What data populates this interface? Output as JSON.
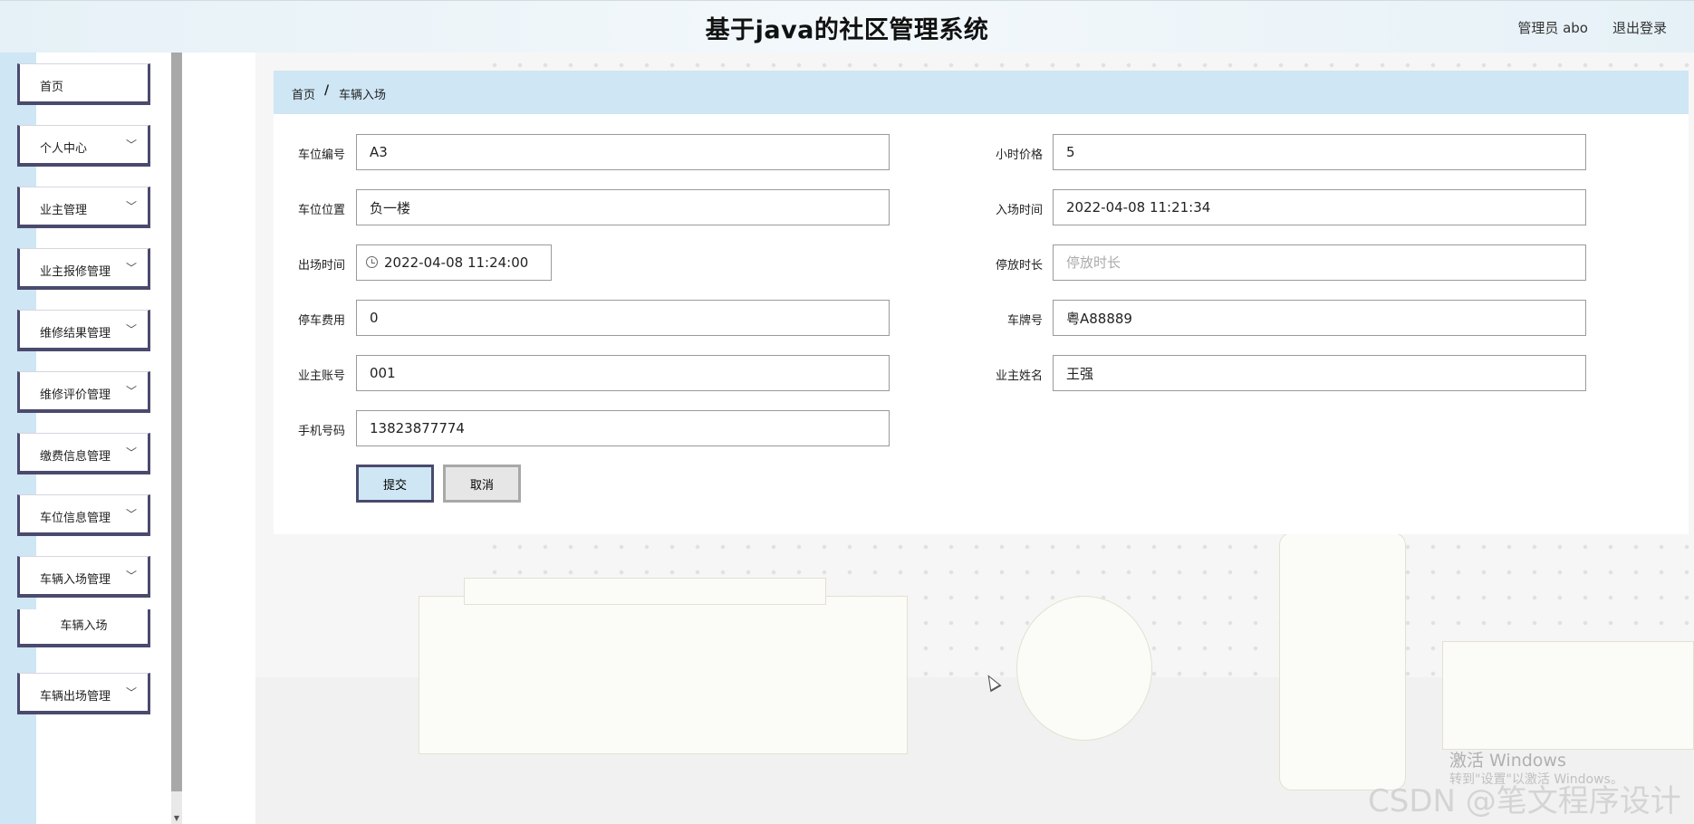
{
  "header": {
    "title": "基于java的社区管理系统",
    "user": "管理员 abo",
    "logout": "退出登录"
  },
  "sidebar": {
    "items": [
      {
        "label": "首页"
      },
      {
        "label": "个人中心"
      },
      {
        "label": "业主管理"
      },
      {
        "label": "业主报修管理"
      },
      {
        "label": "维修结果管理"
      },
      {
        "label": "维修评价管理"
      },
      {
        "label": "缴费信息管理"
      },
      {
        "label": "车位信息管理"
      },
      {
        "label": "车辆入场管理"
      },
      {
        "label": "车辆出场管理"
      }
    ],
    "sub_item": "车辆入场",
    "chevron": "chevron-down-icon"
  },
  "breadcrumb": {
    "home": "首页",
    "sep": "/",
    "current": "车辆入场"
  },
  "form": {
    "spot_no": {
      "label": "车位编号",
      "value": "A3"
    },
    "hour_price": {
      "label": "小时价格",
      "value": "5"
    },
    "spot_loc": {
      "label": "车位位置",
      "value": "负一楼"
    },
    "entry_time": {
      "label": "入场时间",
      "value": "2022-04-08 11:21:34"
    },
    "exit_time": {
      "label": "出场时间",
      "value": "2022-04-08 11:24:00"
    },
    "duration": {
      "label": "停放时长",
      "value": "",
      "placeholder": "停放时长"
    },
    "fee": {
      "label": "停车费用",
      "value": "0"
    },
    "plate": {
      "label": "车牌号",
      "value": "粤A88889"
    },
    "owner_acc": {
      "label": "业主账号",
      "value": "001"
    },
    "owner_name": {
      "label": "业主姓名",
      "value": "王强"
    },
    "phone": {
      "label": "手机号码",
      "value": "13823877774"
    },
    "submit": "提交",
    "cancel": "取消"
  },
  "watermarks": {
    "windows": "激活 Windows",
    "windows_sub": "转到\"设置\"以激活 Windows。",
    "csdn": "CSDN @笔文程序设计"
  }
}
